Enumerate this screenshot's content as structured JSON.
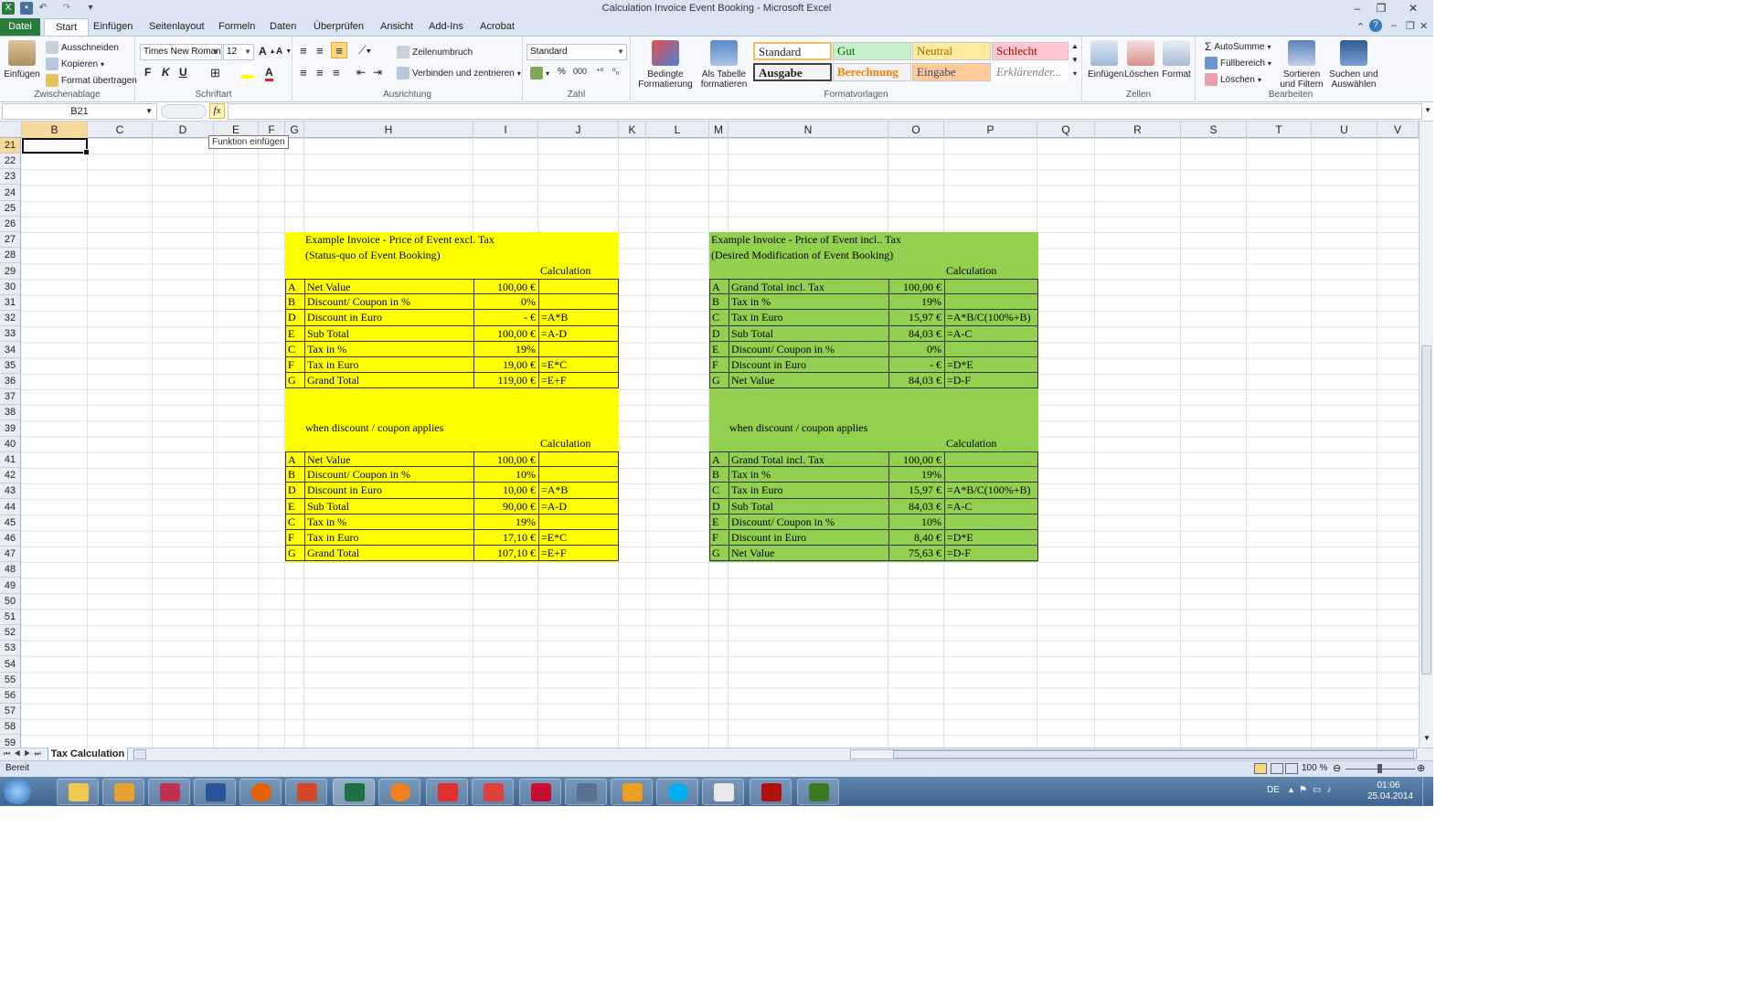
{
  "window": {
    "title": "Calculation Invoice Event Booking  -  Microsoft Excel"
  },
  "tabs": [
    "Datei",
    "Start",
    "Einfügen",
    "Seitenlayout",
    "Formeln",
    "Daten",
    "Überprüfen",
    "Ansicht",
    "Add-Ins",
    "Acrobat"
  ],
  "ribbon": {
    "clipboard": {
      "paste": "Einfügen",
      "cut": "Ausschneiden",
      "copy": "Kopieren",
      "format_painter": "Format übertragen",
      "label": "Zwischenablage"
    },
    "font": {
      "name": "Times New Roman",
      "size": "12",
      "bold": "F",
      "italic": "K",
      "underline": "U",
      "label": "Schriftart"
    },
    "alignment": {
      "wrap": "Zeilenumbruch",
      "merge": "Verbinden und zentrieren",
      "label": "Ausrichtung"
    },
    "number": {
      "format": "Standard",
      "percent": "%",
      "thousands": "000",
      "label": "Zahl"
    },
    "styles": {
      "cond_format": "Bedingte Formatierung",
      "as_table": "Als Tabelle formatieren",
      "standard": "Standard",
      "gut": "Gut",
      "neutral": "Neutral",
      "schlecht": "Schlecht",
      "ausgabe": "Ausgabe",
      "berechnung": "Berechnung",
      "eingabe": "Eingabe",
      "erklaerend": "Erklärender...",
      "label": "Formatvorlagen"
    },
    "cells": {
      "insert": "Einfügen",
      "delete": "Löschen",
      "format": "Format",
      "label": "Zellen"
    },
    "editing": {
      "autosum": "AutoSumme",
      "fill": "Füllbereich",
      "clear": "Löschen",
      "sort": "Sortieren und Filtern",
      "find": "Suchen und Auswählen",
      "label": "Bearbeiten"
    }
  },
  "formula_bar": {
    "name_box": "B21",
    "fx": "fx",
    "formula": ""
  },
  "tooltip": "Funktion einfügen",
  "columns": [
    "B",
    "C",
    "D",
    "E",
    "F",
    "G",
    "H",
    "I",
    "J",
    "K",
    "L",
    "M",
    "N",
    "O",
    "P",
    "Q",
    "R",
    "S",
    "T",
    "U",
    "V"
  ],
  "rows": [
    "21",
    "22",
    "23",
    "24",
    "25",
    "26",
    "27",
    "28",
    "29",
    "30",
    "31",
    "32",
    "33",
    "34",
    "35",
    "36",
    "37",
    "38",
    "39",
    "40",
    "41",
    "42",
    "43",
    "44",
    "45",
    "46",
    "47",
    "48",
    "49",
    "50",
    "51",
    "52",
    "53",
    "54",
    "55",
    "56",
    "57",
    "58",
    "59"
  ],
  "left": {
    "title1": "Example Invoice - Price of Event excl. Tax",
    "title2": "(Status-quo of Event Booking)",
    "calc_header": "Calculation",
    "when": "when discount / coupon applies",
    "calc_header2": "Calculation",
    "table1": [
      {
        "k": "A",
        "label": "Net Value",
        "value": "100,00 €",
        "calc": ""
      },
      {
        "k": "B",
        "label": "Discount/ Coupon in %",
        "value": "0%",
        "calc": ""
      },
      {
        "k": "D",
        "label": "Discount in Euro",
        "value": "-     €",
        "calc": "=A*B"
      },
      {
        "k": "E",
        "label": "Sub Total",
        "value": "100,00 €",
        "calc": "=A-D"
      },
      {
        "k": "C",
        "label": "Tax in %",
        "value": "19%",
        "calc": ""
      },
      {
        "k": "F",
        "label": "Tax in Euro",
        "value": "19,00 €",
        "calc": "=E*C"
      },
      {
        "k": "G",
        "label": "Grand Total",
        "value": "119,00 €",
        "calc": "=E+F"
      }
    ],
    "table2": [
      {
        "k": "A",
        "label": "Net Value",
        "value": "100,00 €",
        "calc": ""
      },
      {
        "k": "B",
        "label": "Discount/ Coupon in %",
        "value": "10%",
        "calc": ""
      },
      {
        "k": "D",
        "label": "Discount in Euro",
        "value": "10,00 €",
        "calc": "=A*B"
      },
      {
        "k": "E",
        "label": "Sub Total",
        "value": "90,00 €",
        "calc": "=A-D"
      },
      {
        "k": "C",
        "label": "Tax in %",
        "value": "19%",
        "calc": ""
      },
      {
        "k": "F",
        "label": "Tax in Euro",
        "value": "17,10 €",
        "calc": "=E*C"
      },
      {
        "k": "G",
        "label": "Grand Total",
        "value": "107,10 €",
        "calc": "=E+F"
      }
    ]
  },
  "right": {
    "title1": "Example Invoice - Price of Event incl.. Tax",
    "title2": "(Desired Modification of Event Booking)",
    "calc_header": "Calculation",
    "when": "when discount / coupon applies",
    "calc_header2": "Calculation",
    "table1": [
      {
        "k": "A",
        "label": "Grand Total incl. Tax",
        "value": "100,00 €",
        "calc": ""
      },
      {
        "k": "B",
        "label": "Tax in %",
        "value": "19%",
        "calc": ""
      },
      {
        "k": "C",
        "label": "Tax in Euro",
        "value": "15,97 €",
        "calc": "=A*B/C(100%+B)"
      },
      {
        "k": "D",
        "label": "Sub Total",
        "value": "84,03 €",
        "calc": "=A-C"
      },
      {
        "k": "E",
        "label": "Discount/ Coupon in %",
        "value": "0%",
        "calc": ""
      },
      {
        "k": "F",
        "label": "Discount in Euro",
        "value": "-     €",
        "calc": "=D*E"
      },
      {
        "k": "G",
        "label": "Net Value",
        "value": "84,03 €",
        "calc": "=D-F"
      }
    ],
    "table2": [
      {
        "k": "A",
        "label": "Grand Total incl. Tax",
        "value": "100,00 €",
        "calc": ""
      },
      {
        "k": "B",
        "label": "Tax in %",
        "value": "19%",
        "calc": ""
      },
      {
        "k": "C",
        "label": "Tax in Euro",
        "value": "15,97 €",
        "calc": "=A*B/C(100%+B)"
      },
      {
        "k": "D",
        "label": "Sub Total",
        "value": "84,03 €",
        "calc": "=A-C"
      },
      {
        "k": "E",
        "label": "Discount/ Coupon in %",
        "value": "10%",
        "calc": ""
      },
      {
        "k": "F",
        "label": "Discount in Euro",
        "value": "8,40 €",
        "calc": "=D*E"
      },
      {
        "k": "G",
        "label": "Net Value",
        "value": "75,63 €",
        "calc": "=D-F"
      }
    ]
  },
  "sheet_tab": "Tax Calculation",
  "status": {
    "ready": "Bereit",
    "zoom": "100 %"
  },
  "taskbar": {
    "lang": "DE",
    "time": "01:06",
    "date": "25.04.2014"
  },
  "colors": {
    "yellow": "#ffff00",
    "green": "#92d050",
    "excel_green": "#2a7b3c"
  }
}
